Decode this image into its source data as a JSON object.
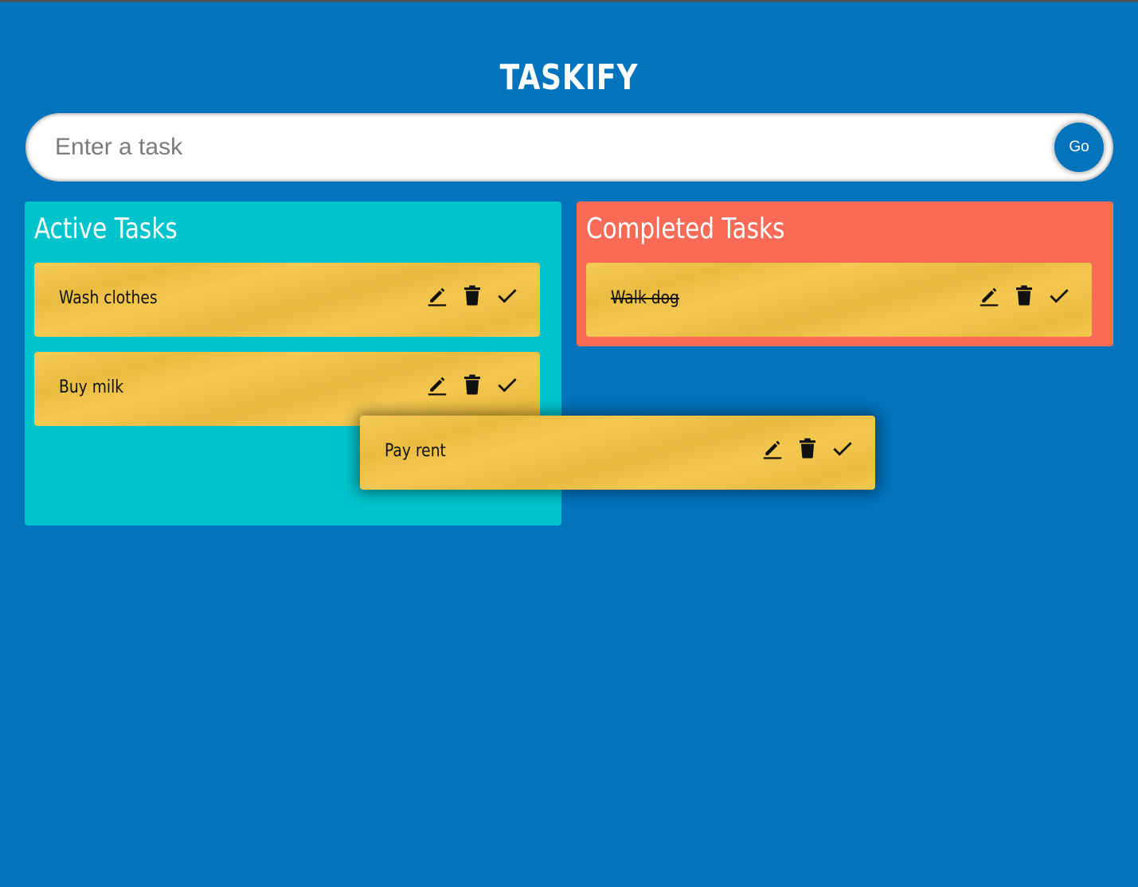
{
  "app": {
    "title": "TASKIFY"
  },
  "input": {
    "placeholder": "Enter a task",
    "value": "",
    "submit_label": "Go"
  },
  "active": {
    "heading": "Active Tasks",
    "tasks": [
      {
        "text": "Wash clothes"
      },
      {
        "text": "Buy milk"
      }
    ]
  },
  "completed": {
    "heading": "Completed Tasks",
    "tasks": [
      {
        "text": "Walk dog"
      }
    ]
  },
  "dragging": {
    "text": "Pay rent"
  },
  "icons": {
    "edit": "pencil-icon",
    "delete": "trash-icon",
    "done": "check-icon"
  },
  "colors": {
    "background": "#0174bd",
    "active_panel": "#00c4cc",
    "completed_panel": "#f96a57",
    "task_card": "#f3c443"
  }
}
